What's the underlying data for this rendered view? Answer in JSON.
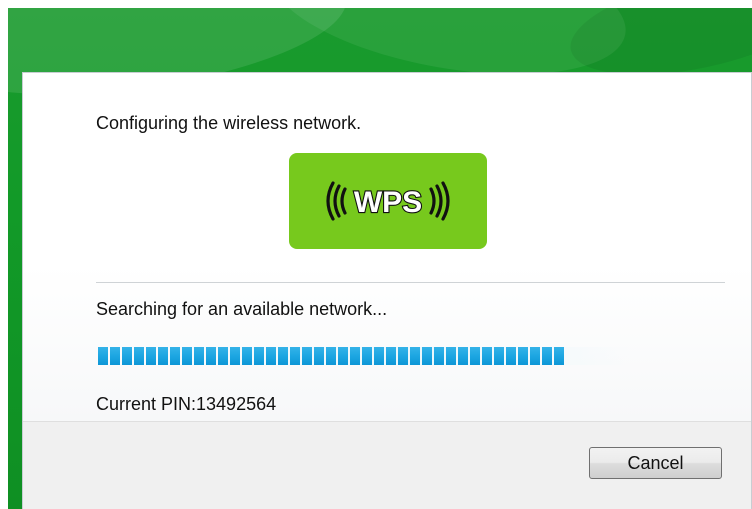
{
  "dialog": {
    "heading": "Configuring the wireless network.",
    "logo_text": "WPS",
    "status": "Searching for an available network...",
    "pin_line": "Current PIN:13492564",
    "progress_fraction": 0.88,
    "cancel_label": "Cancel"
  },
  "colors": {
    "window_frame": "#129a28",
    "logo_background": "#77c91d",
    "progress_fill": "#1ca6e2"
  },
  "icons": {
    "logo": "wps-logo-icon"
  }
}
